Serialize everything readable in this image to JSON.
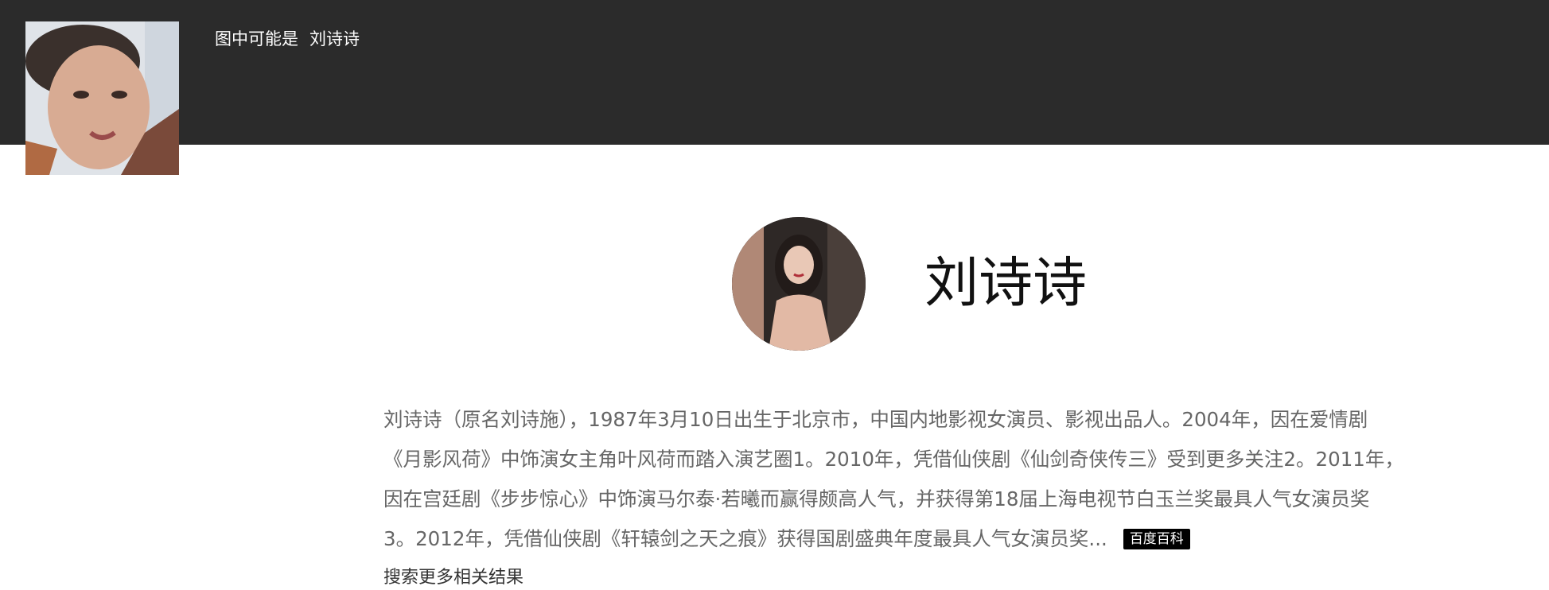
{
  "header": {
    "prefix": "图中可能是",
    "match_name": "刘诗诗"
  },
  "profile": {
    "name": "刘诗诗"
  },
  "bio": {
    "lines": [
      "刘诗诗（原名刘诗施），1987年3月10日出生于北京市，中国内地影视女演员、影视出品人。2004年，因在爱情剧",
      "《月影风荷》中饰演女主角叶风荷而踏入演艺圈1。2010年，凭借仙侠剧《仙剑奇侠传三》受到更多关注2。2011年，",
      "因在宫廷剧《步步惊心》中饰演马尔泰·若曦而赢得颇高人气，并获得第18届上海电视节白玉兰奖最具人气女演员奖",
      "3。2012年，凭借仙侠剧《轩辕剑之天之痕》获得国剧盛典年度最具人气女演员奖..."
    ],
    "source_badge": "百度百科"
  },
  "more_link": "搜索更多相关结果",
  "colors": {
    "header_bg": "#2b2b2b",
    "badge_bg": "#000000",
    "bio_text": "#666666"
  }
}
